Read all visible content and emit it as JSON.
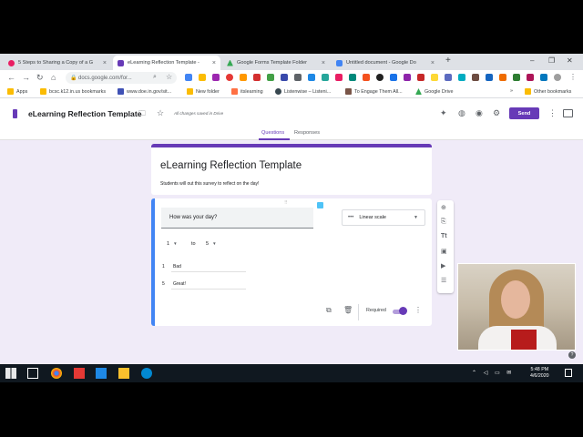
{
  "browser": {
    "tabs": [
      {
        "label": "5 Steps to Sharing a Copy of a G",
        "icon": "tab-favicon-icon",
        "color": "#e91e63"
      },
      {
        "label": "eLearning Reflection Template -",
        "icon": "forms-favicon-icon",
        "color": "#673ab7"
      },
      {
        "label": "Google Forms Template Folder",
        "icon": "drive-favicon-icon",
        "color": "#34a853"
      },
      {
        "label": "Untitled document - Google Do",
        "icon": "docs-favicon-icon",
        "color": "#4285f4"
      }
    ],
    "new_tab": "+",
    "url": "docs.google.com/for...",
    "bookmarks": [
      {
        "label": "Apps",
        "color": "#fbbc04"
      },
      {
        "label": "bcsc.k12.in.us bookmarks",
        "color": "#fbbc04"
      },
      {
        "label": "www.doe.in.gov/sit...",
        "color": "#3f51b5"
      },
      {
        "label": "New folder",
        "color": "#fbbc04"
      },
      {
        "label": "itslearning",
        "color": "#ff7043"
      },
      {
        "label": "Listenwise – Listeni...",
        "color": "#37474f"
      },
      {
        "label": "To Engage Them All...",
        "color": "#795548"
      },
      {
        "label": "Google Drive",
        "color": "#34a853"
      },
      {
        "label": "Other bookmarks",
        "color": "#fbbc04"
      }
    ],
    "more_bookmarks": "»"
  },
  "forms_header": {
    "title": "eLearning Reflection Template",
    "saved_status": "All changes saved in Drive",
    "send_label": "Send",
    "tabs": {
      "questions": "Questions",
      "responses": "Responses"
    },
    "accent_color": "#673ab7"
  },
  "form": {
    "title": "eLearning Reflection Template",
    "description": "Students will out this survey to reflect on the day!",
    "question": {
      "text": "How was your day?",
      "type_label": "Linear scale",
      "scale_min": "1",
      "scale_to": "to",
      "scale_max": "5",
      "labels": [
        {
          "num": "1",
          "text": "Bad"
        },
        {
          "num": "5",
          "text": "Great!"
        }
      ],
      "required_label": "Required",
      "required_on": true
    }
  },
  "taskbar": {
    "time": "5:48 PM",
    "date": "4/6/2020"
  }
}
